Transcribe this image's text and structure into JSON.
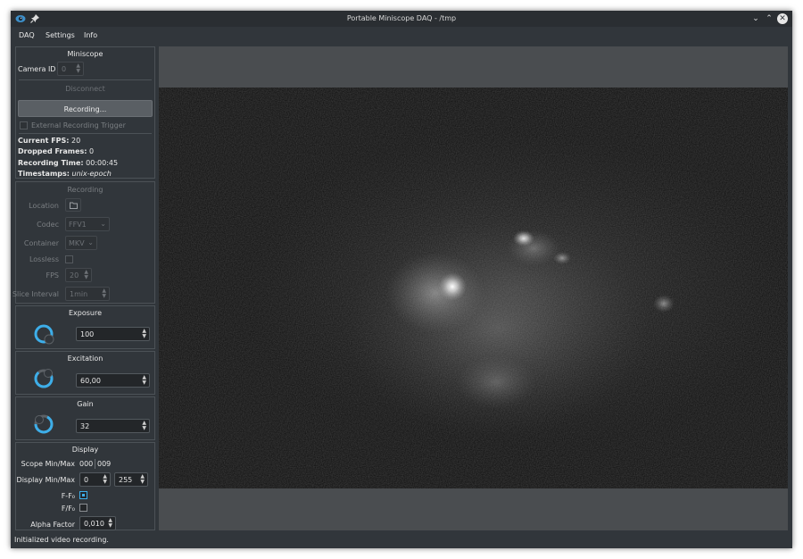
{
  "window": {
    "title": "Portable Miniscope DAQ - /tmp"
  },
  "menu": [
    "DAQ",
    "Settings",
    "Info"
  ],
  "miniscope": {
    "header": "Miniscope",
    "camera_id_label": "Camera ID",
    "camera_id_value": "0",
    "disconnect_label": "Disconnect",
    "recording_button": "Recording...",
    "external_trigger_label": "External Recording Trigger",
    "fps_label": "Current FPS:",
    "fps_value": "20",
    "dropped_label": "Dropped Frames:",
    "dropped_value": "0",
    "rec_time_label": "Recording Time:",
    "rec_time_value": "00:00:45",
    "timestamps_label": "Timestamps:",
    "timestamps_value": "unix-epoch"
  },
  "recording": {
    "header": "Recording",
    "location_label": "Location",
    "codec_label": "Codec",
    "codec_value": "FFV1",
    "container_label": "Container",
    "container_value": "MKV",
    "lossless_label": "Lossless",
    "fps_label": "FPS",
    "fps_value": "20",
    "slice_label": "Slice Interval",
    "slice_value": "1min"
  },
  "exposure": {
    "header": "Exposure",
    "value": "100"
  },
  "excitation": {
    "header": "Excitation",
    "value": "60,00"
  },
  "gain": {
    "header": "Gain",
    "value": "32"
  },
  "display": {
    "header": "Display",
    "scope_minmax_label": "Scope Min/Max",
    "scope_min": "000",
    "scope_max": "009",
    "display_minmax_label": "Display Min/Max",
    "display_min": "0",
    "display_max": "255",
    "ff0_label": "F-F₀",
    "ff0_checked": true,
    "f_f0_label": "F/F₀",
    "f_f0_checked": false,
    "alpha_label": "Alpha Factor",
    "alpha_value": "0,010"
  },
  "statusbar": {
    "text": "Initialized video recording."
  },
  "colors": {
    "accent": "#3daee9",
    "background": "#31363b",
    "button": "#4f5459"
  }
}
